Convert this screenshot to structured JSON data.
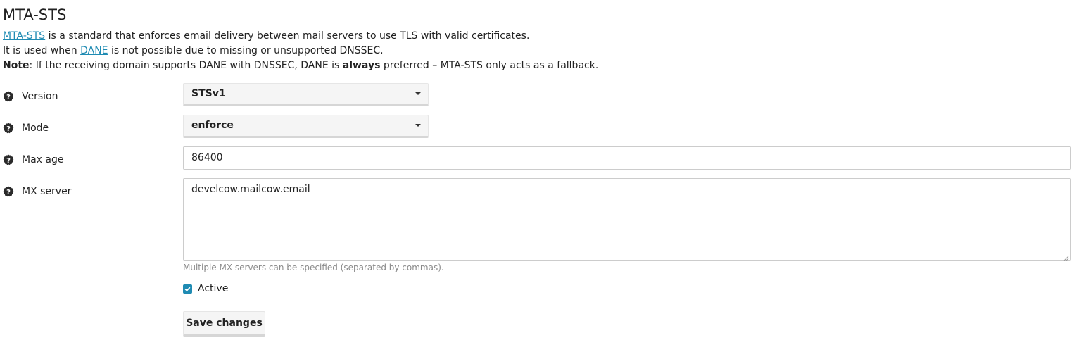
{
  "section": {
    "title": "MTA-STS"
  },
  "description": {
    "line1_link": "MTA-STS",
    "line1_text": " is a standard that enforces email delivery between mail servers to use TLS with valid certificates.",
    "line2_prefix": "It is used when ",
    "line2_link": "DANE",
    "line2_suffix": " is not possible due to missing or unsupported DNSSEC.",
    "line3_note": "Note",
    "line3_text_a": ": If the receiving domain supports DANE with DNSSEC, DANE is ",
    "line3_bold": "always",
    "line3_text_b": " preferred – MTA-STS only acts as a fallback."
  },
  "form": {
    "version": {
      "label": "Version",
      "value": "STSv1"
    },
    "mode": {
      "label": "Mode",
      "value": "enforce"
    },
    "max_age": {
      "label": "Max age",
      "value": "86400"
    },
    "mx_server": {
      "label": "MX server",
      "value": "develcow.mailcow.email",
      "help": "Multiple MX servers can be specified (separated by commas)."
    },
    "active": {
      "label": "Active",
      "checked": true
    },
    "save_label": "Save changes"
  },
  "icons": {
    "help": "help-circle-icon",
    "caret": "caret-down-icon",
    "check": "check-icon"
  },
  "colors": {
    "accent": "#1f8bb3",
    "text": "#222222",
    "muted": "#8a8a8a"
  }
}
